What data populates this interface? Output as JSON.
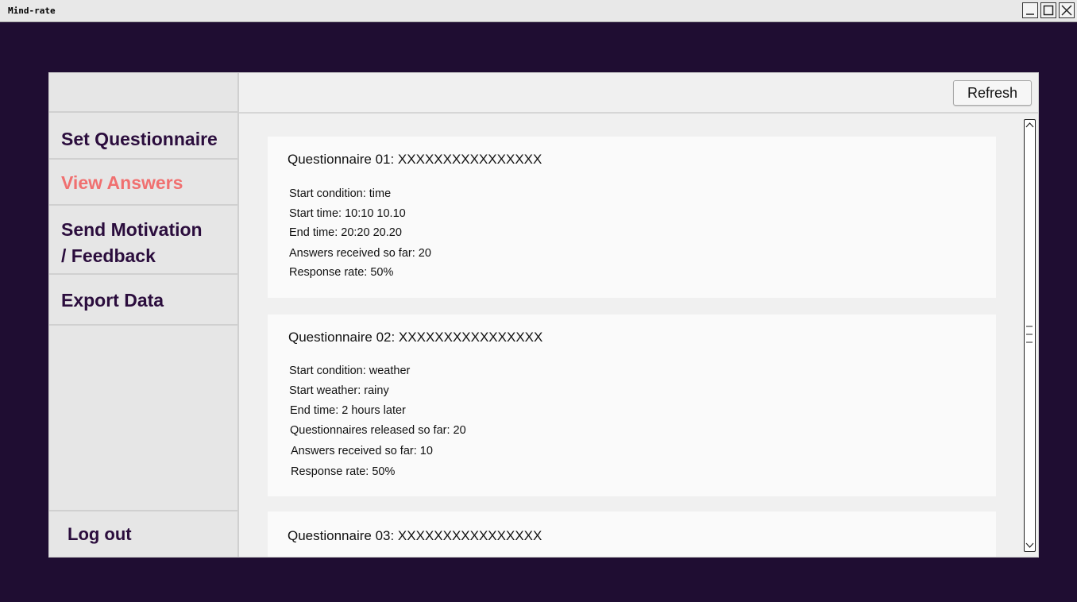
{
  "window": {
    "title": "Mind-rate"
  },
  "sidebar": {
    "items": [
      {
        "label": "Set Questionnaire"
      },
      {
        "label": "View Answers",
        "active": true
      },
      {
        "label_line1": "Send Motivation",
        "label_line2": "/ Feedback"
      },
      {
        "label": "Export Data"
      }
    ],
    "logout_label": "Log out"
  },
  "header": {
    "refresh_label": "Refresh"
  },
  "questionnaires": [
    {
      "title": "Questionnaire 01: XXXXXXXXXXXXXXXX",
      "lines": [
        "Start condition: time",
        "Start time: 10:10 10.10",
        "End time: 20:20 20.20",
        "Answers received so far: 20",
        "Response rate: 50%"
      ]
    },
    {
      "title": "Questionnaire 02: XXXXXXXXXXXXXXXX",
      "lines": [
        "Start condition: weather",
        "Start weather: rainy",
        "End time: 2 hours later",
        "Questionnaires released so far: 20",
        "Answers received so far: 10",
        "Response rate: 50%"
      ]
    },
    {
      "title": "Questionnaire 03: XXXXXXXXXXXXXXXX"
    }
  ],
  "colors": {
    "background": "#1f0d32",
    "nav_text": "#2b0d3d",
    "nav_active": "#f07070"
  }
}
